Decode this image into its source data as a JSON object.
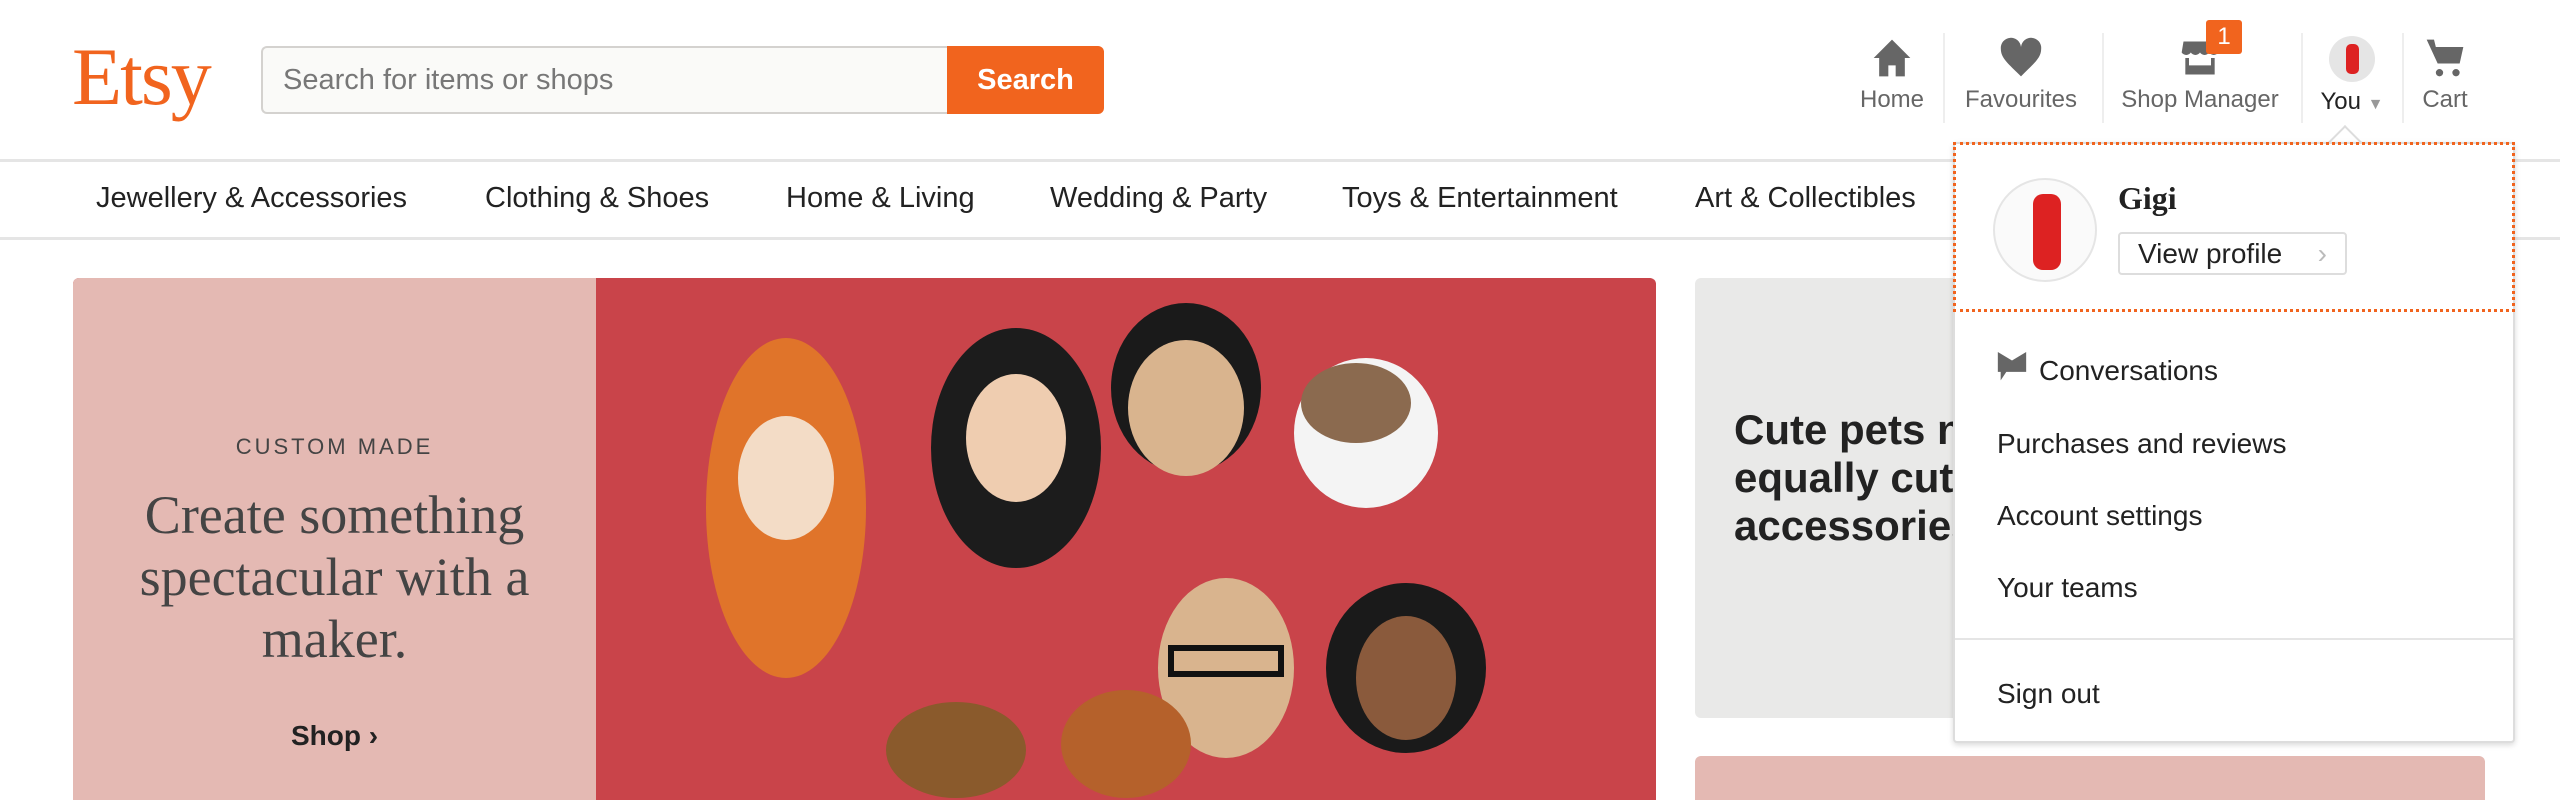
{
  "header": {
    "logo": "Etsy",
    "search_placeholder": "Search for items or shops",
    "search_button": "Search",
    "nav": [
      {
        "label": "Home",
        "icon": "home-icon"
      },
      {
        "label": "Favourites",
        "icon": "heart-icon"
      },
      {
        "label": "Shop Manager",
        "icon": "shop-icon",
        "badge": "1"
      },
      {
        "label": "You",
        "icon": "avatar"
      },
      {
        "label": "Cart",
        "icon": "cart-icon"
      }
    ]
  },
  "categories": [
    "Jewellery & Accessories",
    "Clothing & Shoes",
    "Home & Living",
    "Wedding & Party",
    "Toys & Entertainment",
    "Art & Collectibles"
  ],
  "hero": {
    "eyebrow": "CUSTOM MADE",
    "headline": "Create something spectacular with a maker.",
    "cta": "Shop"
  },
  "card2": {
    "text": "Cute pets need equally cute accessories"
  },
  "dropdown": {
    "name": "Gigi",
    "view_profile": "View profile",
    "items": [
      "Conversations",
      "Purchases and reviews",
      "Account settings",
      "Your teams"
    ],
    "sign_out": "Sign out"
  },
  "colors": {
    "brand": "#F1641E",
    "hero_pink": "#E4B9B3",
    "hero_red": "#C9444A"
  }
}
